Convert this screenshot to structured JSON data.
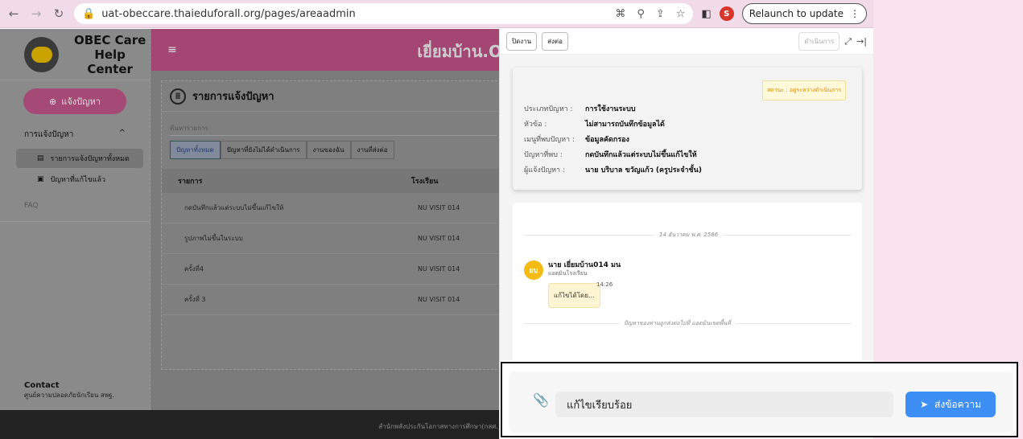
{
  "browser": {
    "url": "uat-obeccare.thaieduforall.org/pages/areaadmin",
    "profile_initial": "S",
    "relaunch_label": "Relaunch to update"
  },
  "sidebar": {
    "logo_line1": "OBEC Care",
    "logo_line2": "Help Center",
    "report_button": "แจ้งปัญหา",
    "section": "การแจ้งปัญหา",
    "items": [
      {
        "label": "รายการแจ้งปัญหาทั้งหมด"
      },
      {
        "label": "ปัญหาที่แก้ไขแล้ว"
      }
    ],
    "faq": "FAQ",
    "contact_title": "Contact",
    "contact_sub": "ศูนย์ความปลอดภัยนักเรียน สพฐ."
  },
  "header": {
    "title": "เยี่ยมบ้าน.O"
  },
  "list": {
    "title": "รายการแจ้งปัญหา",
    "search_placeholder": "ค้นหารายการ",
    "tabs": [
      "ปัญหาทั้งหมด",
      "ปัญหาที่ยังไม่ได้ดำเนินการ",
      "งานของฉัน",
      "งานที่ส่งต่อ"
    ],
    "columns": [
      "รายการ",
      "โรงเรียน"
    ],
    "rows": [
      [
        "กดบันทึกแล้วแต่ระบบไม่ขึ้นแก้ไขให้",
        "NU VISIT 014"
      ],
      [
        "รูปภาพไม่ขึ้นในระบบ",
        "NU VISIT 014"
      ],
      [
        "ครั้งที่4",
        "NU VISIT 014"
      ],
      [
        "ครั้งที่ 3",
        "NU VISIT 014"
      ]
    ]
  },
  "footer": {
    "text": "สำนักพลังประกันโอกาสทางการศึกษา(กสศ.)"
  },
  "panel": {
    "close_btn": "ปิดงาน",
    "forward_btn": "ส่งต่อ",
    "action_btn": "ดำเนินการ",
    "status": "สถานะ : อยู่ระหว่างดำเนินการ",
    "info": [
      {
        "k": "ประเภทปัญหา :",
        "v": "การใช้งานระบบ"
      },
      {
        "k": "หัวข้อ :",
        "v": "ไม่สามารถบันทึกข้อมูลได้"
      },
      {
        "k": "เมนูที่พบปัญหา :",
        "v": "ข้อมูลคัดกรอง"
      },
      {
        "k": "ปัญหาที่พบ :",
        "v": "กดบันทึกแล้วแต่ระบบไม่ขึ้นแก้ไขให้"
      },
      {
        "k": "ผู้แจ้งปัญหา :",
        "v": "นาย บริบาล ขวัญแก้ว (ครูประจำชั้น)"
      }
    ],
    "chat": {
      "date": "14 ธันวาคม พ.ศ. 2566",
      "avatar": "ยบ",
      "sender": "นาย เยี่ยมบ้าน014 มน",
      "role": "แอดมินโรงเรียน",
      "message": "แก้ไขได้โดย...",
      "time": "14:26",
      "notice": "ปัญหาของท่านถูกส่งต่อไปที่ แอดมินเขตพื้นที่"
    }
  },
  "composer": {
    "value": "แก้ไขเรียบร้อย",
    "send_label": "ส่งข้อความ"
  },
  "colors": {
    "accent": "#3d8ff5",
    "status": "#e08a00",
    "avatar": "#f5bb12"
  }
}
